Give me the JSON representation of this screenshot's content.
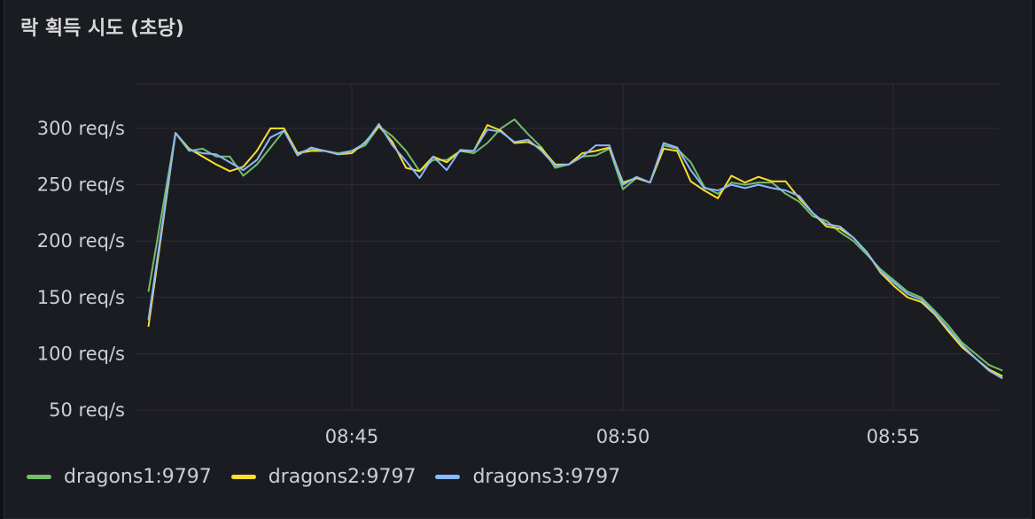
{
  "panel": {
    "title": "락 획득 시도 (초당)"
  },
  "chart_data": {
    "type": "line",
    "title": "락 획득 시도 (초당)",
    "xlabel": "",
    "ylabel": "",
    "x": [
      "08:41:15",
      "08:41:45",
      "08:42:00",
      "08:42:15",
      "08:42:30",
      "08:42:45",
      "08:43:00",
      "08:43:15",
      "08:43:30",
      "08:43:45",
      "08:44:00",
      "08:44:15",
      "08:44:30",
      "08:44:45",
      "08:45:00",
      "08:45:15",
      "08:45:30",
      "08:45:45",
      "08:46:00",
      "08:46:15",
      "08:46:30",
      "08:46:45",
      "08:47:00",
      "08:47:15",
      "08:47:30",
      "08:47:45",
      "08:48:00",
      "08:48:15",
      "08:48:30",
      "08:48:45",
      "08:49:00",
      "08:49:15",
      "08:49:30",
      "08:49:45",
      "08:50:00",
      "08:50:15",
      "08:50:30",
      "08:50:45",
      "08:51:00",
      "08:51:15",
      "08:51:30",
      "08:51:45",
      "08:52:00",
      "08:52:15",
      "08:52:30",
      "08:52:45",
      "08:53:00",
      "08:53:15",
      "08:53:30",
      "08:53:45",
      "08:54:00",
      "08:54:15",
      "08:54:30",
      "08:54:45",
      "08:55:00",
      "08:55:15",
      "08:55:30",
      "08:55:45",
      "08:56:00",
      "08:56:15",
      "08:56:30",
      "08:56:45"
    ],
    "series": [
      {
        "name": "dragons1:9797",
        "color": "#73bf69",
        "values": [
          155,
          296,
          280,
          282,
          275,
          275,
          258,
          268,
          283,
          298,
          278,
          282,
          280,
          278,
          280,
          285,
          302,
          293,
          280,
          262,
          272,
          272,
          280,
          278,
          287,
          300,
          308,
          295,
          283,
          265,
          268,
          275,
          276,
          282,
          246,
          256,
          252,
          285,
          282,
          270,
          248,
          242,
          252,
          250,
          252,
          252,
          242,
          235,
          222,
          218,
          208,
          200,
          188,
          175,
          165,
          155,
          150,
          138,
          125,
          110,
          100,
          90,
          85
        ]
      },
      {
        "name": "dragons2:9797",
        "color": "#fade2a",
        "values": [
          124,
          296,
          282,
          275,
          268,
          262,
          266,
          280,
          300,
          300,
          278,
          280,
          280,
          277,
          278,
          288,
          302,
          288,
          265,
          262,
          275,
          270,
          280,
          280,
          303,
          298,
          287,
          288,
          282,
          268,
          268,
          278,
          280,
          283,
          252,
          256,
          252,
          282,
          280,
          253,
          245,
          238,
          258,
          252,
          257,
          253,
          253,
          238,
          225,
          213,
          211,
          203,
          190,
          172,
          160,
          150,
          146,
          135,
          120,
          106,
          96,
          86,
          80
        ]
      },
      {
        "name": "dragons3:9797",
        "color": "#8ab8ff",
        "values": [
          130,
          296,
          281,
          278,
          277,
          270,
          263,
          272,
          292,
          298,
          276,
          283,
          280,
          277,
          280,
          287,
          304,
          285,
          271,
          256,
          275,
          263,
          281,
          280,
          299,
          297,
          288,
          290,
          280,
          267,
          268,
          275,
          285,
          285,
          250,
          257,
          252,
          287,
          283,
          263,
          247,
          245,
          250,
          247,
          250,
          247,
          245,
          240,
          225,
          215,
          213,
          203,
          190,
          173,
          163,
          153,
          148,
          136,
          122,
          108,
          96,
          85,
          78
        ]
      }
    ],
    "y_ticks": [
      "50 req/s",
      "100 req/s",
      "150 req/s",
      "200 req/s",
      "250 req/s",
      "300 req/s"
    ],
    "x_ticks": [
      "08:45",
      "08:50",
      "08:55"
    ],
    "ylim": [
      50,
      350
    ],
    "grid": true,
    "legend": "bottom-left"
  }
}
